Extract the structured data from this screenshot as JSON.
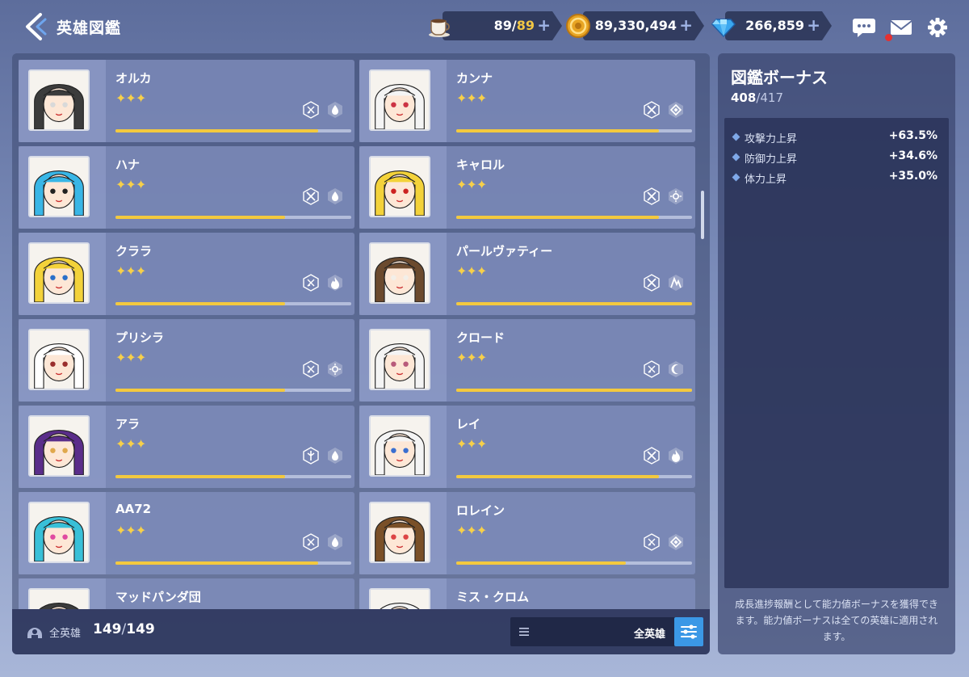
{
  "header": {
    "title": "英雄図鑑"
  },
  "resources": {
    "stamina": {
      "current": "89",
      "max": "89",
      "sep": "/",
      "plus": "+"
    },
    "gold": {
      "value": "89,330,494",
      "plus": "+"
    },
    "gems": {
      "value": "266,859",
      "plus": "+"
    }
  },
  "heroes": [
    {
      "name": "オルカ",
      "stars": "✦✦✦",
      "progress": 0.86,
      "badges": [
        "class-icon",
        "water-element-icon"
      ]
    },
    {
      "name": "カンナ",
      "stars": "✦✦✦",
      "progress": 0.86,
      "badges": [
        "sword-class-icon",
        "diamond-element-icon"
      ]
    },
    {
      "name": "ハナ",
      "stars": "✦✦✦",
      "progress": 0.72,
      "badges": [
        "sword-class-icon",
        "water-element-icon"
      ]
    },
    {
      "name": "キャロル",
      "stars": "✦✦✦",
      "progress": 0.86,
      "badges": [
        "sword-class-icon",
        "light-element-icon"
      ]
    },
    {
      "name": "クララ",
      "stars": "✦✦✦",
      "progress": 0.72,
      "badges": [
        "class-icon",
        "fire-element-icon"
      ]
    },
    {
      "name": "パールヴァティー",
      "stars": "✦✦✦",
      "progress": 1.0,
      "badges": [
        "sword-class-icon",
        "earth-element-icon"
      ]
    },
    {
      "name": "プリシラ",
      "stars": "✦✦✦",
      "progress": 0.72,
      "badges": [
        "class-icon",
        "light-element-icon"
      ]
    },
    {
      "name": "クロード",
      "stars": "✦✦✦",
      "progress": 1.0,
      "badges": [
        "class-icon",
        "moon-element-icon"
      ]
    },
    {
      "name": "アラ",
      "stars": "✦✦✦",
      "progress": 0.72,
      "badges": [
        "support-class-icon",
        "water-element-icon"
      ]
    },
    {
      "name": "レイ",
      "stars": "✦✦✦",
      "progress": 0.86,
      "badges": [
        "sword-class-icon",
        "fire-element-icon"
      ]
    },
    {
      "name": "AA72",
      "stars": "✦✦✦",
      "progress": 0.86,
      "badges": [
        "class-icon",
        "water-element-icon"
      ]
    },
    {
      "name": "ロレイン",
      "stars": "✦✦✦",
      "progress": 0.72,
      "badges": [
        "class-icon",
        "diamond-element-icon"
      ]
    },
    {
      "name": "マッドパンダ団",
      "stars": "",
      "progress": 0,
      "badges": []
    },
    {
      "name": "ミス・クロム",
      "stars": "",
      "progress": 0,
      "badges": []
    }
  ],
  "footer": {
    "label": "全英雄",
    "count": "149",
    "total": "149",
    "sep": "/",
    "filter_value": "全英雄"
  },
  "bonus": {
    "title": "図鑑ボーナス",
    "current": "408",
    "max": "417",
    "sep": "/",
    "items": [
      {
        "label": "攻撃力上昇",
        "value": "+63.5%"
      },
      {
        "label": "防御力上昇",
        "value": "+34.6%"
      },
      {
        "label": "体力上昇",
        "value": "+35.0%"
      }
    ],
    "note": "成長進捗報酬として能力値ボーナスを獲得できます。能力値ボーナスは全ての英雄に適用されます。"
  },
  "colors": {
    "accent_blue": "#3b98e6",
    "star_gold": "#f7d04a",
    "progress_gold": "#f3c93e",
    "notification_red": "#e53030"
  }
}
